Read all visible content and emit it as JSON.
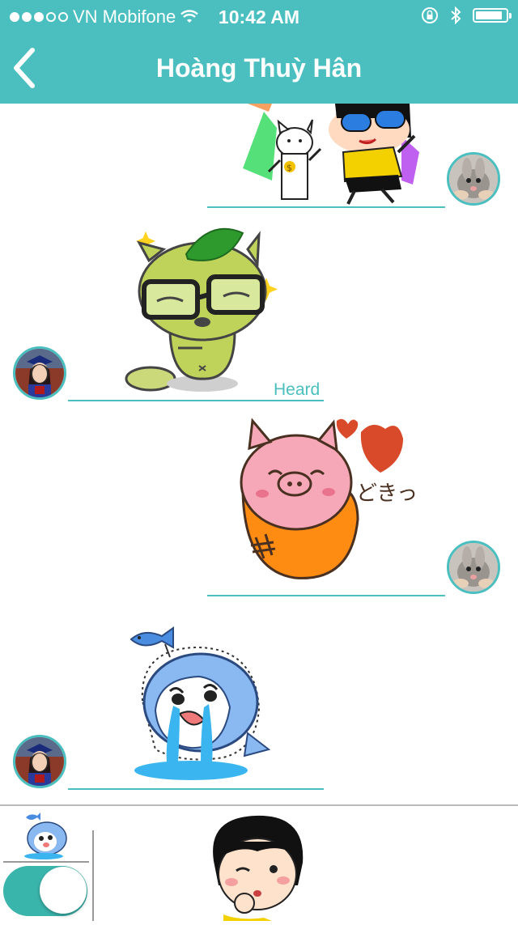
{
  "status_bar": {
    "carrier": "VN Mobifone",
    "time": "10:42 AM",
    "signal_dots_filled": 3,
    "signal_dots_total": 5
  },
  "nav": {
    "title": "Hoàng Thuỳ Hân",
    "back_icon": "chevron-left-icon"
  },
  "messages": [
    {
      "side": "right",
      "sticker": "girl-sunglasses-cat-sticker",
      "avatar": "rabbit-avatar"
    },
    {
      "side": "left",
      "sticker": "leaf-raccoon-glasses-sticker",
      "avatar": "girl-graduation-avatar",
      "status": "Heard"
    },
    {
      "side": "right",
      "sticker": "pig-heart-dokitsu-sticker",
      "sticker_text": "どきっ",
      "avatar": "rabbit-avatar"
    },
    {
      "side": "left",
      "sticker": "crying-shark-fish-sticker",
      "avatar": "girl-graduation-avatar"
    }
  ],
  "composer": {
    "selected_sticker": "crying-shark-fish-sticker",
    "preview_sticker": "girl-ok-wink-sticker",
    "toggle_on": true
  },
  "colors": {
    "accent": "#4bbfbf",
    "toggle": "#3ab5ac"
  }
}
